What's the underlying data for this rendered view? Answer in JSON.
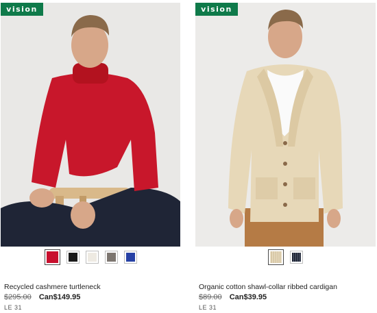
{
  "products": [
    {
      "brand": "vision",
      "title": "Recycled cashmere turtleneck",
      "old_price": "$295.00",
      "new_price": "Can$149.95",
      "code": "LE 31",
      "swatches": [
        "#c8102e",
        "#1a1a1a",
        "#eeeae2",
        "#7d7670",
        "#2741a5"
      ],
      "selected_swatch": 0
    },
    {
      "brand": "vision",
      "title": "Organic cotton shawl-collar ribbed cardigan",
      "old_price": "$89.00",
      "new_price": "Can$39.95",
      "code": "LE 31",
      "swatches": [
        "#e8dcc1",
        "#1e2433"
      ],
      "selected_swatch": 0
    }
  ],
  "colors": {
    "brand_badge": "#0f7a4a"
  }
}
